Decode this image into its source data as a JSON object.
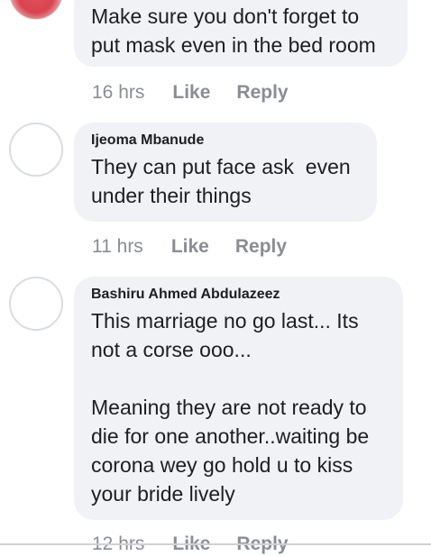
{
  "comments": [
    {
      "author": "",
      "text": "Make sure you don't forget to\nput mask even in the bed room",
      "time": "16 hrs",
      "like": "Like",
      "reply": "Reply"
    },
    {
      "author": "Ijeoma Mbanude",
      "text": "They can put face ask  even\nunder their things",
      "time": "11 hrs",
      "like": "Like",
      "reply": "Reply"
    },
    {
      "author": "Bashiru Ahmed Abdulazeez",
      "text": "This marriage no go last... Its\nnot a corse ooo...\n\nMeaning they are not ready to\ndie for one another..waiting be\ncorona wey go hold u to kiss\nyour bride lively",
      "time": "12 hrs",
      "like": "Like",
      "reply": "Reply"
    }
  ],
  "colors": {
    "bubble": "#f0f2f5",
    "meta": "#8a8d91",
    "avatar_border": "#dadde1",
    "text": "#1c1e21"
  },
  "icons": {
    "comment_1_avatar": "profile-photo",
    "comment_2_avatar": "empty-avatar-circle",
    "comment_3_avatar": "empty-avatar-circle"
  }
}
